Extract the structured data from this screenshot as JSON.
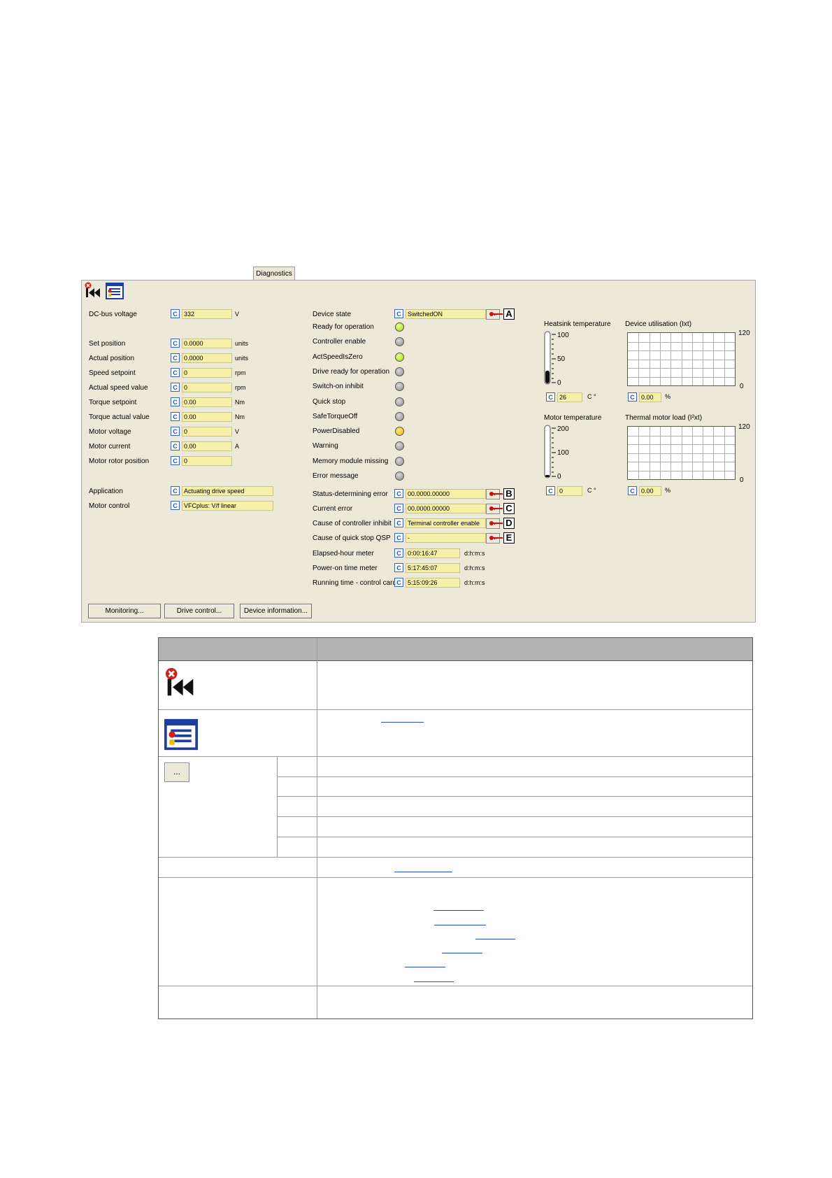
{
  "tab": {
    "label": "Diagnostics"
  },
  "toolbar": {
    "icons": [
      "reset-error-icon",
      "logbook-icon"
    ]
  },
  "left_params": [
    {
      "label": "DC-bus voltage",
      "value": "332",
      "unit": "V"
    },
    {
      "label": "Set position",
      "value": "0.0000",
      "unit": "units"
    },
    {
      "label": "Actual position",
      "value": "0.0000",
      "unit": "units"
    },
    {
      "label": "Speed setpoint",
      "value": "0",
      "unit": "rpm"
    },
    {
      "label": "Actual speed value",
      "value": "0",
      "unit": "rpm"
    },
    {
      "label": "Torque setpoint",
      "value": "0.00",
      "unit": "Nm"
    },
    {
      "label": "Torque actual value",
      "value": "0.00",
      "unit": "Nm"
    },
    {
      "label": "Motor voltage",
      "value": "0",
      "unit": "V"
    },
    {
      "label": "Motor current",
      "value": "0.00",
      "unit": "A"
    },
    {
      "label": "Motor rotor position",
      "value": "0",
      "unit": ""
    },
    {
      "label": "Application",
      "value": "Actuating drive speed",
      "unit": ""
    },
    {
      "label": "Motor control",
      "value": "VFCplus: V/f linear",
      "unit": ""
    }
  ],
  "device_state": {
    "label": "Device state",
    "value": "SwitchedON",
    "marker": "A"
  },
  "status_leds": [
    {
      "label": "Ready for operation",
      "state": "green"
    },
    {
      "label": "Controller enable",
      "state": "gray"
    },
    {
      "label": "ActSpeedIsZero",
      "state": "green"
    },
    {
      "label": "Drive ready for operation",
      "state": "gray"
    },
    {
      "label": "Switch-on inhibit",
      "state": "gray"
    },
    {
      "label": "Quick stop",
      "state": "gray"
    },
    {
      "label": "SafeTorqueOff",
      "state": "gray"
    },
    {
      "label": "PowerDisabled",
      "state": "yellow"
    },
    {
      "label": "Warning",
      "state": "gray"
    },
    {
      "label": "Memory module missing",
      "state": "gray"
    },
    {
      "label": "Error message",
      "state": "gray"
    }
  ],
  "error_fields": [
    {
      "label": "Status-determining error",
      "value": "00.0000.00000",
      "marker": "B"
    },
    {
      "label": "Current error",
      "value": "00.0000.00000",
      "marker": "C"
    },
    {
      "label": "Cause of controller inhibit",
      "value": "Terminal controller enable",
      "marker": "D"
    },
    {
      "label": "Cause of quick stop QSP",
      "value": "-",
      "marker": "E"
    }
  ],
  "time_fields": [
    {
      "label": "Elapsed-hour meter",
      "value": "0:00:16:47",
      "unit": "d:h:m:s"
    },
    {
      "label": "Power-on time meter",
      "value": "5:17:45:07",
      "unit": "d:h:m:s"
    },
    {
      "label": "Running time - control card",
      "value": "5:15:09:26",
      "unit": "d:h:m:s"
    }
  ],
  "heatsink": {
    "title": "Heatsink temperature",
    "scale": [
      "100",
      "50",
      "0"
    ],
    "value": "26",
    "unit": "C °",
    "level": 26
  },
  "motor_temp": {
    "title": "Motor temperature",
    "scale": [
      "200",
      "100",
      "0"
    ],
    "value": "0",
    "unit": "C °",
    "level": 0
  },
  "device_util": {
    "title": "Device utilisation (Ixt)",
    "max": "120",
    "min": "0",
    "value": "0.00",
    "unit": "%"
  },
  "thermal_load": {
    "title": "Thermal motor load (I²xt)",
    "max": "120",
    "min": "0",
    "value": "0.00",
    "unit": "%"
  },
  "buttons": {
    "monitoring": "Monitoring...",
    "drive_control": "Drive control...",
    "device_info": "Device information..."
  },
  "legend": {
    "dots_button": "..."
  },
  "colors": {
    "panel_bg": "#ece9d8",
    "field_bg": "#f7f0a8",
    "table_header_bg": "#b4b4b4",
    "link": "#1f4fd0"
  }
}
